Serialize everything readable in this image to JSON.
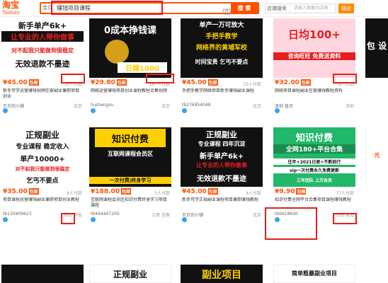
{
  "header": {
    "logo_main": "淘宝",
    "logo_sub": "Taobao",
    "scope": "宝贝",
    "query": "赚钱项目课程",
    "search_button": "搜 索",
    "shop_scope": "店铺搜索",
    "shop_placeholder": "请输入搜索的店铺",
    "shop_button": "搜店"
  },
  "products": [
    {
      "img_lines": [
        "新手单产6k+",
        "让专业的人带你做事",
        "对不起我只能做到很稳定",
        "无效退款不墨迹"
      ],
      "price": "¥45.00",
      "sold": "35人付款",
      "title": "新手可学运营赚钱视频在家副业兼职项目创业",
      "shop": "贝贝的小铺",
      "loc": "北京"
    },
    {
      "img_lines": [
        "0成本挣钱课",
        "日赚1000"
      ],
      "price": "¥29.80",
      "sold": "167人付款",
      "title": "网络运营赚钱项目创业课程教程合集视频",
      "shop": "liushengxu",
      "loc": "北京"
    },
    {
      "img_lines": [
        "单产一万可放大",
        "手把手教学",
        "网络界的黄埔军校",
        "时间宝贵 乞丐不要点"
      ],
      "price": "¥45.00",
      "sold": "33人付款",
      "title": "手把手教学网络项目新手赚钱副业课程",
      "shop": "tb276954048",
      "loc": "北京"
    },
    {
      "img_lines": [
        "日均100+",
        "咨询旺旺 免费送资料"
      ],
      "price": "¥32.00",
      "sold": "78人付款",
      "title": "网络项目课程副业在家赚钱教程资料",
      "shop": "深圳 蓝月",
      "loc": "深圳"
    },
    {
      "img_lines": [
        "正规副业",
        "专业课程 稳定收入",
        "单产10000+",
        "对不起我只能做到很稳定",
        "乞丐不要点"
      ],
      "price": "¥35.00",
      "sold": "8人付款",
      "title": "项目课程运营赚钱副业兼职项目创业教程",
      "shop": "tb135809623",
      "loc": "陕西 西安"
    },
    {
      "img_lines": [
        "知识付费",
        "互联网课程会员区",
        "一次付费|终身学习"
      ],
      "price": "¥188.00",
      "sold": "5人付款",
      "title": "互联网课程会员区知识付费终身学习项目课程",
      "shop": "tb464447200",
      "loc": "江西 宜春"
    },
    {
      "img_lines": [
        "正规副业",
        "专业课程 四年沉淀",
        "新手单产6k+",
        "让专业的人带你做事",
        "无效退款不墨迹"
      ],
      "price": "¥45.00",
      "sold": "4人付款",
      "title": "新手可学正规副业课程项目兼职赚钱教程",
      "shop": "贝贝的小铺",
      "loc": "北京"
    },
    {
      "img_lines": [
        "知识付费",
        "全网180+平台合集",
        "往年+2021日更+不断前行",
        "vip一次付费永久免费更新",
        "三年团队 上万会员"
      ],
      "price": "¥9.90",
      "sold": "77人付款",
      "title": "知识付费全网平台合集项目课程赚钱教程",
      "shop": "tb6618600",
      "loc": "山东 青岛"
    }
  ],
  "partial_right_top": "包 设",
  "partial_right_bottom": "元",
  "bottom_row": [
    "正规副业",
    "副业项目",
    "简单粗暴副业项目"
  ]
}
